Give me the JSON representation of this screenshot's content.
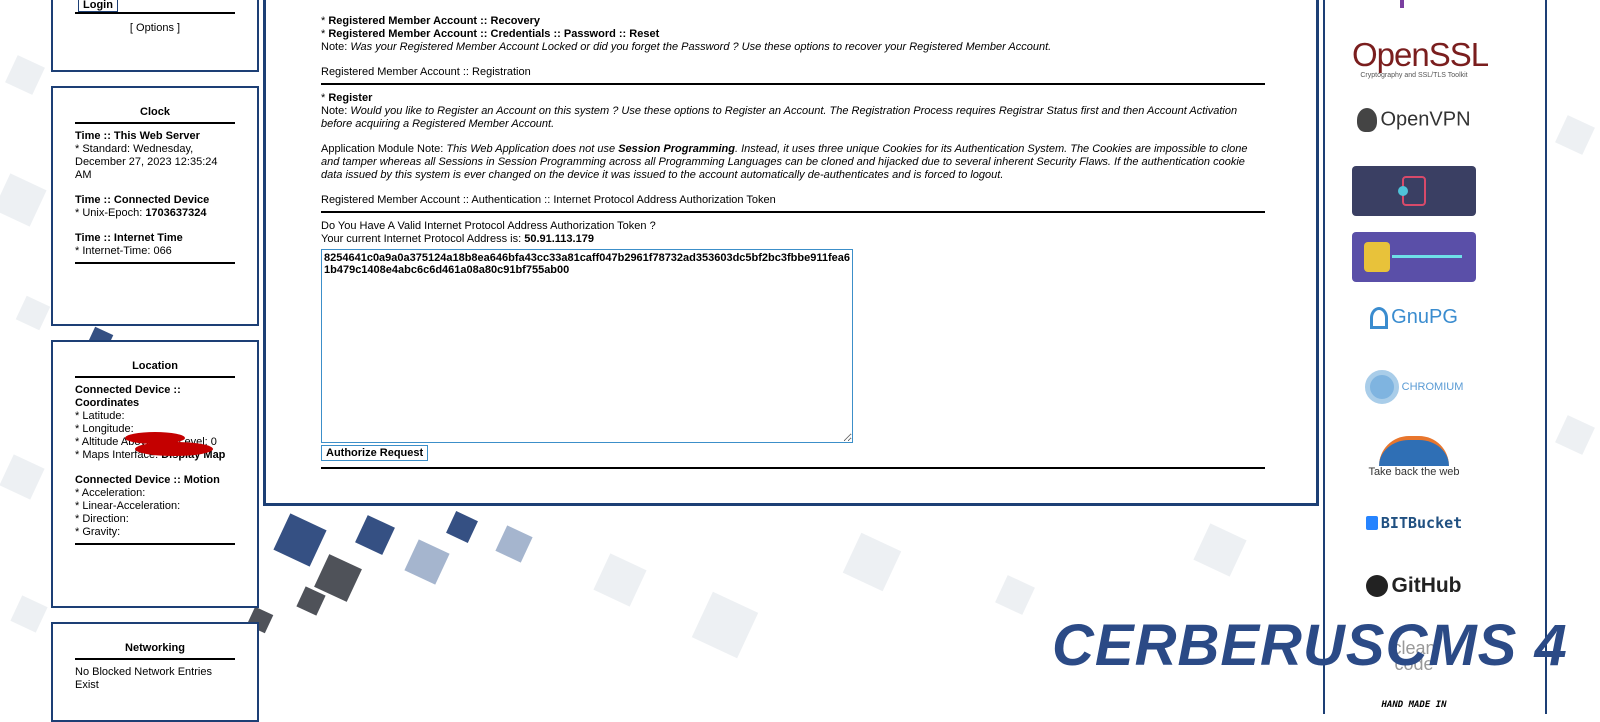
{
  "login": {
    "button_label": "Login",
    "options_label": "Options"
  },
  "clock": {
    "title": "Clock",
    "server_heading": "Time :: This Web Server",
    "server_standard": "* Standard: Wednesday, December 27, 2023 12:35:24 AM",
    "device_heading": "Time :: Connected Device",
    "unix_label": "* Unix-Epoch: ",
    "unix_value": "1703637324",
    "internet_heading": "Time :: Internet Time",
    "internet_value": "* Internet-Time: 066"
  },
  "location": {
    "title": "Location",
    "coords_heading": "Connected Device :: Coordinates",
    "latitude_label": "* Latitude:",
    "longitude_label": "* Longitude:",
    "altitude": "* Altitude Above Sea-Level: 0",
    "maps_label": "* Maps Interface: ",
    "maps_link": "Display Map",
    "motion_heading": "Connected Device :: Motion",
    "acceleration": "* Acceleration:",
    "linear_acceleration": "* Linear-Acceleration:",
    "direction": "* Direction:",
    "gravity": "* Gravity:"
  },
  "networking": {
    "title": "Networking",
    "status": "No Blocked Network Entries Exist"
  },
  "main": {
    "recovery_link": "Registered Member Account :: Recovery",
    "reset_link": "Registered Member Account :: Credentials :: Password :: Reset",
    "recovery_note_label": "Note: ",
    "recovery_note": "Was your Registered Member Account Locked or did you forget the Password ? Use these options to recover your Registered Member Account.",
    "registration_heading": "Registered Member Account :: Registration",
    "register_link": "Register",
    "register_note_label": "Note: ",
    "register_note": "Would you like to Register an Account on this system ? Use these options to Register an Account. The Registration Process requires Registrar Status first and then Account Activation before acquiring a Registered Member Account.",
    "app_note_label": "Application Module Note: ",
    "app_note_1": "This Web Application does not use ",
    "app_note_bold": "Session Programming",
    "app_note_2": ". Instead, it uses three unique Cookies for its Authentication System. The Cookies are impossible to clone and tamper whereas all Sessions in Session Programming across all Programming Languages can be cloned and hijacked due to several inherent Security Flaws. If the authentication cookie data issued by this system is ever changed on the device it was issued to the account automatically de-authenticates and is forced to logout.",
    "auth_heading": "Registered Member Account :: Authentication :: Internet Protocol Address Authorization Token",
    "token_question": "Do You Have A Valid Internet Protocol Address Authorization Token ?",
    "ip_label": "Your current Internet Protocol Address is: ",
    "ip_value": "50.91.113.179",
    "token_value": "8254641c0a9a0a375124a18b8ea646bfa43cc33a81caff047b2961f78732ad353603dc5bf2bc3fbbe911fea61b479c1408e4abc6c6d461a08a80c91bf755ab00",
    "authorize_button": "Authorize Request"
  },
  "sponsors": {
    "openssl": "OpenSSL",
    "openssl_sub": "Cryptography and SSL/TLS Toolkit",
    "openvpn": "OpenVPN",
    "gnupg": "GnuPG",
    "chromium": "CHROMIUM",
    "firefox": "Take back the web",
    "bitbucket": "BITBucket",
    "github": "GitHub",
    "cleancode_1": "clean",
    "cleancode_2": "code",
    "handmade": "HAND MADE IN"
  },
  "brand": "CERBERUSCMS 4"
}
